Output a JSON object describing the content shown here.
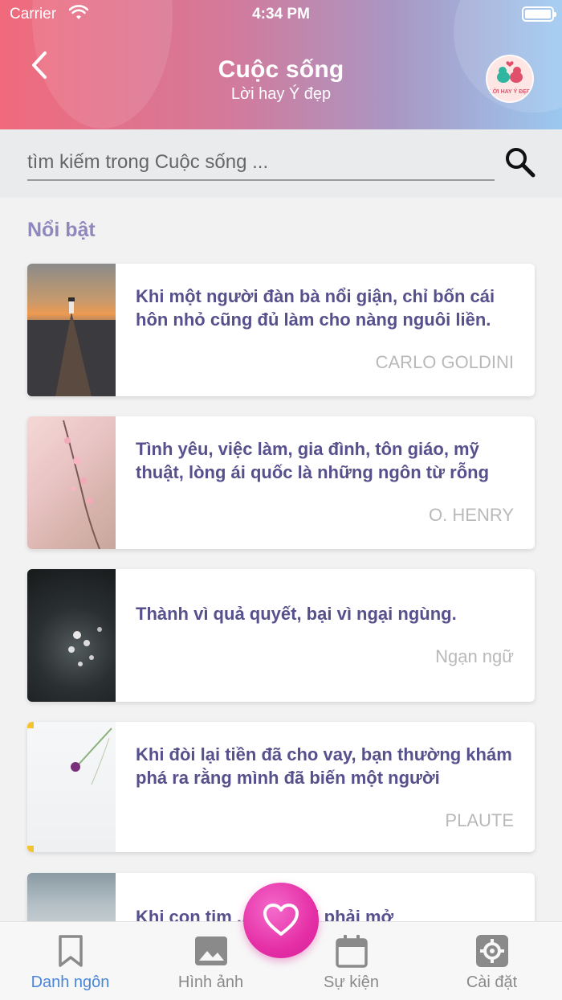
{
  "status_bar": {
    "carrier": "Carrier",
    "time": "4:34 PM"
  },
  "header": {
    "title": "Cuộc sống",
    "subtitle": "Lời hay Ý đẹp",
    "logo_text": "LỜI HAY Ý ĐẸP"
  },
  "search": {
    "placeholder": "tìm kiếm trong Cuộc sống ..."
  },
  "section": {
    "title": "Nổi bật"
  },
  "quotes": [
    {
      "text": "Khi một người đàn bà nổi giận, chỉ bốn cái hôn nhỏ cũng đủ làm cho nàng nguôi liền.",
      "author": "CARLO GOLDINI"
    },
    {
      "text": "Tình yêu, việc làm, gia đình, tôn giáo, mỹ thuật, lòng ái quốc là những ngôn từ rỗng",
      "author": "O. HENRY"
    },
    {
      "text": "Thành vì quả quyết, bại vì ngại ngùng.",
      "author": "Ngạn ngữ"
    },
    {
      "text": "Khi đòi lại tiền đã cho vay, bạn thường khám phá ra rằng mình đã biến một người",
      "author": "PLAUTE"
    },
    {
      "text": "Khi con tim ... đôi môi phải mở",
      "author": ""
    }
  ],
  "tabs": [
    {
      "label": "Danh ngôn",
      "icon": "bookmark-icon",
      "active": true
    },
    {
      "label": "Hình ảnh",
      "icon": "image-icon",
      "active": false
    },
    {
      "label": "Sự kiện",
      "icon": "calendar-icon",
      "active": false
    },
    {
      "label": "Cài đặt",
      "icon": "gear-icon",
      "active": false
    }
  ],
  "colors": {
    "accent": "#4a86d8",
    "quote_text": "#56508c",
    "section_title": "#8f88bd",
    "fab": "#e52fa6"
  }
}
